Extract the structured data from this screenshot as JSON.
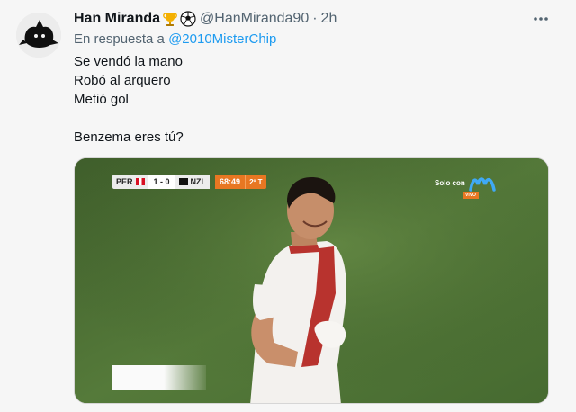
{
  "tweet": {
    "display_name": "Han Miranda",
    "name_emojis": [
      "trophy-icon",
      "soccer-ball-icon"
    ],
    "handle": "@HanMiranda90",
    "separator": "·",
    "time": "2h",
    "reply_prefix": "En respuesta a",
    "reply_to": "@2010MisterChip",
    "body_lines": [
      "Se vendó la mano",
      "Robó al arquero",
      "Metió gol",
      "",
      "Benzema eres tú?"
    ],
    "more_icon": "more-horizontal-icon"
  },
  "media": {
    "scoreboard": {
      "home": "PER",
      "score": "1 - 0",
      "away": "NZL",
      "clock": "68:49",
      "half": "2º T"
    },
    "broadcast_label": "Solo con",
    "broadcast_badge": "VIVO",
    "broadcaster_icon": "movistar-logo-icon"
  },
  "colors": {
    "link": "#1d9bf0",
    "secondary_text": "#536471",
    "clock_bg": "#e87722",
    "pitch": "#4a6b34",
    "brand": "#3fa9f5"
  }
}
